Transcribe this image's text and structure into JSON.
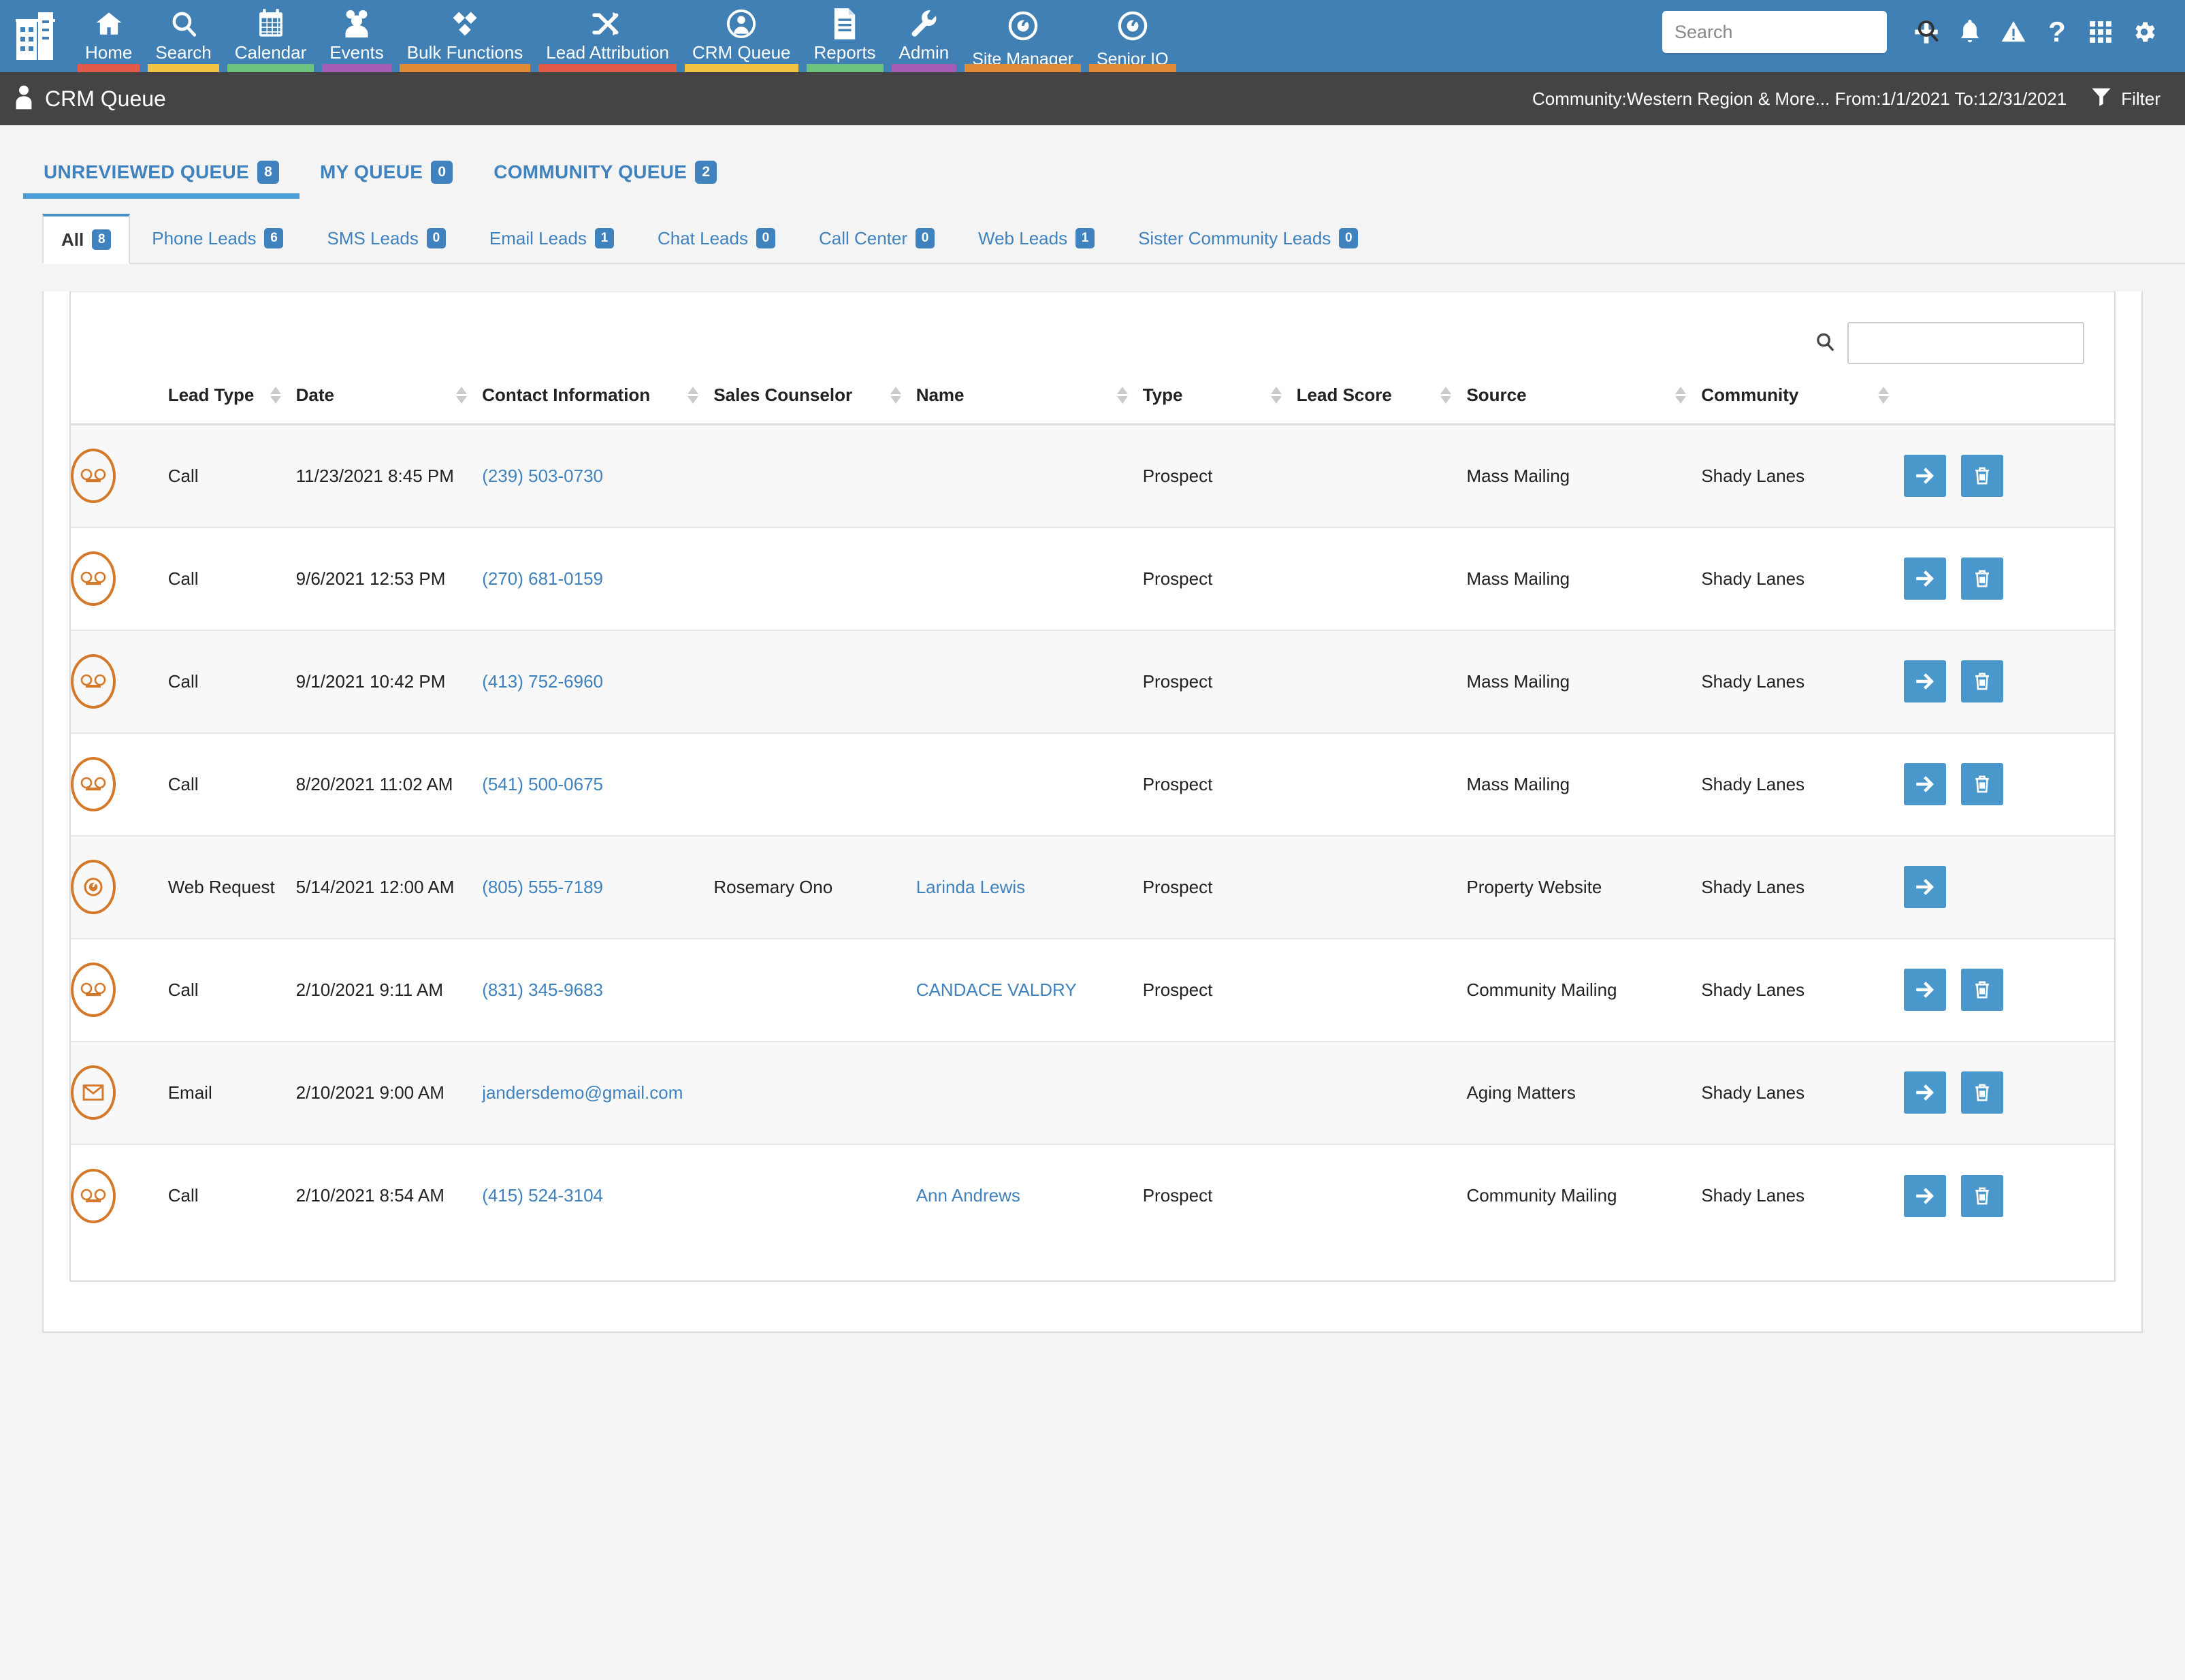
{
  "navbar": {
    "logo_icon": "building-logo-icon",
    "items": [
      {
        "label": "Home",
        "icon": "home-icon",
        "stripe": "#e05a47"
      },
      {
        "label": "Search",
        "icon": "search-icon",
        "stripe": "#f0c345"
      },
      {
        "label": "Calendar",
        "icon": "calendar-icon",
        "stripe": "#6bc47d"
      },
      {
        "label": "Events",
        "icon": "events-people-icon",
        "stripe": "#a45cb5"
      },
      {
        "label": "Bulk Functions",
        "icon": "bulk-functions-diamond-icon",
        "stripe": "#e08a35"
      },
      {
        "label": "Lead Attribution",
        "icon": "shuffle-icon",
        "stripe": "#e05a47"
      },
      {
        "label": "CRM Queue",
        "icon": "crm-queue-person-target-icon",
        "stripe": "#f0c345"
      },
      {
        "label": "Reports",
        "icon": "reports-document-icon",
        "stripe": "#6bc47d"
      },
      {
        "label": "Admin",
        "icon": "wrench-icon",
        "stripe": "#a45cb5"
      },
      {
        "label": "Site Manager",
        "icon": "site-manager-circle-icon",
        "stripe": "#e08a35"
      },
      {
        "label": "Senior IQ",
        "icon": "senior-iq-circle-icon",
        "stripe": "#e08a35"
      }
    ],
    "search": {
      "placeholder": "Search",
      "value": "",
      "icon": "search-icon"
    },
    "actions": [
      {
        "name": "add-button",
        "icon": "plus-icon"
      },
      {
        "name": "notifications-button",
        "icon": "bell-icon"
      },
      {
        "name": "alerts-button",
        "icon": "warning-triangle-icon"
      },
      {
        "name": "help-button",
        "icon": "question-mark-icon"
      },
      {
        "name": "apps-button",
        "icon": "grid-apps-icon"
      },
      {
        "name": "settings-button",
        "icon": "gear-icon"
      }
    ]
  },
  "subheader": {
    "icon": "person-icon",
    "title": "CRM Queue",
    "filter_summary": "Community:Western Region & More... From:1/1/2021 To:12/31/2021",
    "filter_label": "Filter",
    "filter_icon": "funnel-icon"
  },
  "queue_tabs": [
    {
      "label": "UNREVIEWED QUEUE",
      "count": "8",
      "active": true
    },
    {
      "label": "MY QUEUE",
      "count": "0",
      "active": false
    },
    {
      "label": "COMMUNITY QUEUE",
      "count": "2",
      "active": false
    }
  ],
  "sub_tabs": [
    {
      "label": "All",
      "count": "8",
      "active": true
    },
    {
      "label": "Phone Leads",
      "count": "6",
      "active": false
    },
    {
      "label": "SMS Leads",
      "count": "0",
      "active": false
    },
    {
      "label": "Email Leads",
      "count": "1",
      "active": false
    },
    {
      "label": "Chat Leads",
      "count": "0",
      "active": false
    },
    {
      "label": "Call Center",
      "count": "0",
      "active": false
    },
    {
      "label": "Web Leads",
      "count": "1",
      "active": false
    },
    {
      "label": "Sister Community Leads",
      "count": "0",
      "active": false
    }
  ],
  "table": {
    "search": {
      "value": "",
      "placeholder": "",
      "icon": "search-icon"
    },
    "columns": [
      {
        "label": "Lead Type",
        "sortable": true
      },
      {
        "label": "Date",
        "sortable": true
      },
      {
        "label": "Contact Information",
        "sortable": true
      },
      {
        "label": "Sales Counselor",
        "sortable": true
      },
      {
        "label": "Name",
        "sortable": true
      },
      {
        "label": "Type",
        "sortable": true
      },
      {
        "label": "Lead Score",
        "sortable": true
      },
      {
        "label": "Source",
        "sortable": true
      },
      {
        "label": "Community",
        "sortable": true
      }
    ],
    "rows": [
      {
        "icon": "voicemail-icon",
        "lead_type": "Call",
        "date": "11/23/2021 8:45 PM",
        "contact": "(239) 503-0730",
        "counselor": "",
        "name": "",
        "type": "Prospect",
        "lead_score": "",
        "source": "Mass Mailing",
        "community": "Shady Lanes",
        "has_delete": true
      },
      {
        "icon": "voicemail-icon",
        "lead_type": "Call",
        "date": "9/6/2021 12:53 PM",
        "contact": "(270) 681-0159",
        "counselor": "",
        "name": "",
        "type": "Prospect",
        "lead_score": "",
        "source": "Mass Mailing",
        "community": "Shady Lanes",
        "has_delete": true
      },
      {
        "icon": "voicemail-icon",
        "lead_type": "Call",
        "date": "9/1/2021 10:42 PM",
        "contact": "(413) 752-6960",
        "counselor": "",
        "name": "",
        "type": "Prospect",
        "lead_score": "",
        "source": "Mass Mailing",
        "community": "Shady Lanes",
        "has_delete": true
      },
      {
        "icon": "voicemail-icon",
        "lead_type": "Call",
        "date": "8/20/2021 11:02 AM",
        "contact": "(541) 500-0675",
        "counselor": "",
        "name": "",
        "type": "Prospect",
        "lead_score": "",
        "source": "Mass Mailing",
        "community": "Shady Lanes",
        "has_delete": true
      },
      {
        "icon": "web-request-target-icon",
        "lead_type": "Web Request",
        "date": "5/14/2021 12:00 AM",
        "contact": "(805) 555-7189",
        "counselor": "Rosemary Ono",
        "name": "Larinda Lewis",
        "type": "Prospect",
        "lead_score": "",
        "source": "Property Website",
        "community": "Shady Lanes",
        "has_delete": false
      },
      {
        "icon": "voicemail-icon",
        "lead_type": "Call",
        "date": "2/10/2021 9:11 AM",
        "contact": "(831) 345-9683",
        "counselor": "",
        "name": "CANDACE VALDRY",
        "type": "Prospect",
        "lead_score": "",
        "source": "Community Mailing",
        "community": "Shady Lanes",
        "has_delete": true
      },
      {
        "icon": "email-envelope-icon",
        "lead_type": "Email",
        "date": "2/10/2021 9:00 AM",
        "contact": "jandersdemo@gmail.com",
        "counselor": "",
        "name": "",
        "type": "",
        "lead_score": "",
        "source": "Aging Matters",
        "community": "Shady Lanes",
        "has_delete": true
      },
      {
        "icon": "voicemail-icon",
        "lead_type": "Call",
        "date": "2/10/2021 8:54 AM",
        "contact": "(415) 524-3104",
        "counselor": "",
        "name": "Ann Andrews",
        "type": "Prospect",
        "lead_score": "",
        "source": "Community Mailing",
        "community": "Shady Lanes",
        "has_delete": true
      }
    ],
    "row_actions": {
      "forward_icon": "arrow-right-icon",
      "delete_icon": "trash-icon"
    }
  },
  "colors": {
    "nav_bg": "#4180b5",
    "subheader_bg": "#444444",
    "accent_blue": "#3f82bd",
    "button_blue": "#4a97cc",
    "lead_icon_orange": "#d4792a",
    "page_bg": "#f4f4f4"
  }
}
